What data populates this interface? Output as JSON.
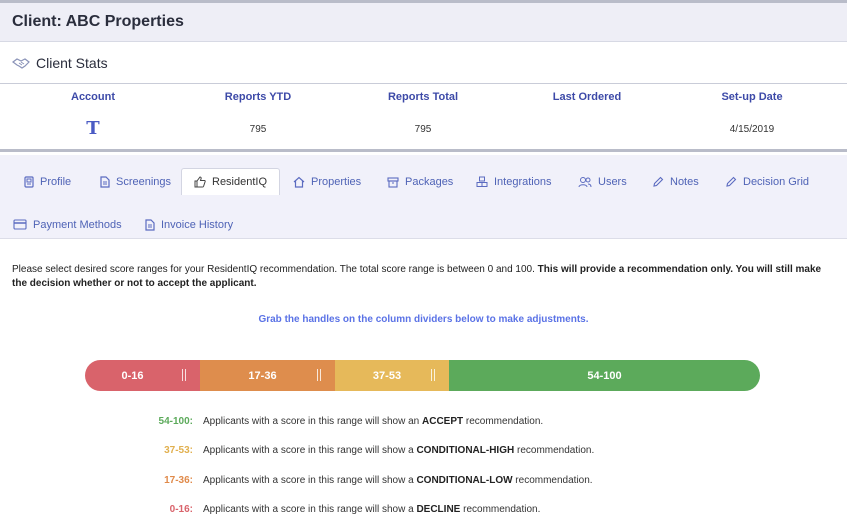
{
  "client": {
    "title": "Client: ABC Properties"
  },
  "stats": {
    "section_title": "Client Stats",
    "columns": [
      {
        "header": "Account",
        "value": "T"
      },
      {
        "header": "Reports YTD",
        "value": "795"
      },
      {
        "header": "Reports Total",
        "value": "795"
      },
      {
        "header": "Last Ordered",
        "value": ""
      },
      {
        "header": "Set-up Date",
        "value": "4/15/2019"
      }
    ]
  },
  "tabs": [
    {
      "label": "Profile",
      "icon": "id-card-icon"
    },
    {
      "label": "Screenings",
      "icon": "document-icon"
    },
    {
      "label": "ResidentIQ",
      "icon": "thumbs-up-icon",
      "active": true
    },
    {
      "label": "Properties",
      "icon": "home-icon"
    },
    {
      "label": "Packages",
      "icon": "package-icon"
    },
    {
      "label": "Integrations",
      "icon": "cubes-icon"
    },
    {
      "label": "Users",
      "icon": "users-icon"
    },
    {
      "label": "Notes",
      "icon": "pencil-icon"
    },
    {
      "label": "Decision Grid",
      "icon": "pencil-icon"
    },
    {
      "label": "Payment Methods",
      "icon": "credit-card-icon"
    },
    {
      "label": "Invoice History",
      "icon": "document-icon"
    }
  ],
  "content": {
    "intro_text": "Please select desired score ranges for your ResidentIQ recommendation. The total score range is between 0 and 100. ",
    "intro_bold": "This will provide a recommendation only. You will still make the decision whether or not to accept the applicant.",
    "hint": "Grab the handles on the column dividers below to make adjustments."
  },
  "score_ranges": [
    {
      "label": "0-16",
      "min": 0,
      "max": 16,
      "color": "#d9636b"
    },
    {
      "label": "17-36",
      "min": 17,
      "max": 36,
      "color": "#de8d4d"
    },
    {
      "label": "37-53",
      "min": 37,
      "max": 53,
      "color": "#e6b95a"
    },
    {
      "label": "54-100",
      "min": 54,
      "max": 100,
      "color": "#5caa5b"
    }
  ],
  "legend": [
    {
      "range": "54-100:",
      "color": "#5caa5b",
      "prefix": "Applicants with a score in this range will show an ",
      "keyword": "ACCEPT",
      "suffix": " recommendation."
    },
    {
      "range": "37-53:",
      "color": "#e1b04f",
      "prefix": "Applicants with a score in this range will show a ",
      "keyword": "CONDITIONAL-HIGH",
      "suffix": " recommendation."
    },
    {
      "range": "17-36:",
      "color": "#e08a4a",
      "prefix": "Applicants with a score in this range will show a ",
      "keyword": "CONDITIONAL-LOW",
      "suffix": " recommendation."
    },
    {
      "range": "0-16:",
      "color": "#d9636b",
      "prefix": "Applicants with a score in this range will show a ",
      "keyword": "DECLINE",
      "suffix": " recommendation."
    }
  ]
}
